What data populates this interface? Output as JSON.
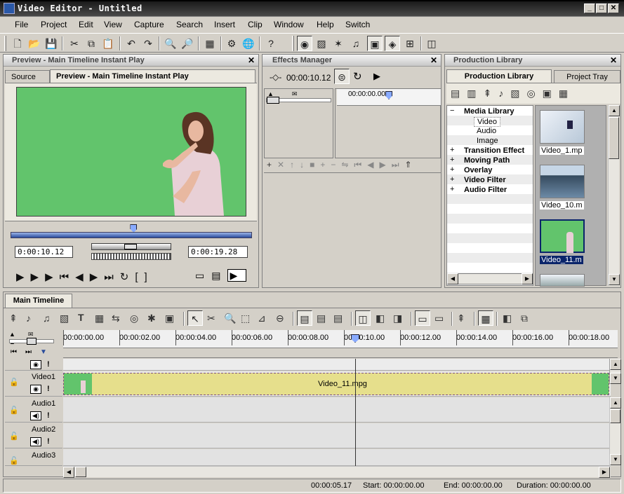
{
  "app": {
    "title": "Video Editor - Untitled"
  },
  "menu": [
    "File",
    "Project",
    "Edit",
    "View",
    "Capture",
    "Search",
    "Insert",
    "Clip",
    "Window",
    "Help",
    "Switch"
  ],
  "preview": {
    "header": "Preview - Main Timeline Instant Play",
    "tab_source": "Source",
    "tab_preview": "Preview - Main Timeline Instant Play",
    "time_current": "0:00:10.12",
    "time_end": "0:00:19.28",
    "progress": 0.51
  },
  "effects": {
    "header": "Effects Manager",
    "time": "00:00:10.12",
    "ruler_start": "00:00:00.00"
  },
  "library": {
    "header": "Production Library",
    "tab_library": "Production Library",
    "tab_tray": "Project Tray",
    "tree": [
      {
        "label": "Media Library",
        "bold": true,
        "exp": "−"
      },
      {
        "label": "Video",
        "bold": false,
        "exp": ""
      },
      {
        "label": "Audio",
        "bold": false,
        "exp": ""
      },
      {
        "label": "Image",
        "bold": false,
        "exp": ""
      },
      {
        "label": "Transition Effect",
        "bold": true,
        "exp": "+"
      },
      {
        "label": "Moving Path",
        "bold": true,
        "exp": "+"
      },
      {
        "label": "Overlay",
        "bold": true,
        "exp": "+"
      },
      {
        "label": "Video Filter",
        "bold": true,
        "exp": "+"
      },
      {
        "label": "Audio Filter",
        "bold": true,
        "exp": "+"
      }
    ],
    "thumbs": [
      {
        "label": "Video_1.mp"
      },
      {
        "label": "Video_10.m"
      },
      {
        "label": "Video_11.m"
      }
    ]
  },
  "timeline": {
    "tab": "Main Timeline",
    "ruler": [
      "00:00:00.00",
      "00:00:02.00",
      "00:00:04.00",
      "00:00:06.00",
      "00:00:08.00",
      "00:00:10.00",
      "00:00:12.00",
      "00:00:14.00",
      "00:00:16.00",
      "00:00:18.00"
    ],
    "tracks": [
      {
        "name": "Video1"
      },
      {
        "name": "Audio1"
      },
      {
        "name": "Audio2"
      },
      {
        "name": "Audio3"
      }
    ],
    "clip": "Video_11.mpg"
  },
  "status": {
    "position": "00:00:05.17",
    "start": "Start: 00:00:00.00",
    "end": "End: 00:00:00.00",
    "duration": "Duration: 00:00:00.00"
  },
  "colors": {
    "green_screen": "#62c46c",
    "clip": "#e6df8c",
    "accent": "#0a246a"
  }
}
